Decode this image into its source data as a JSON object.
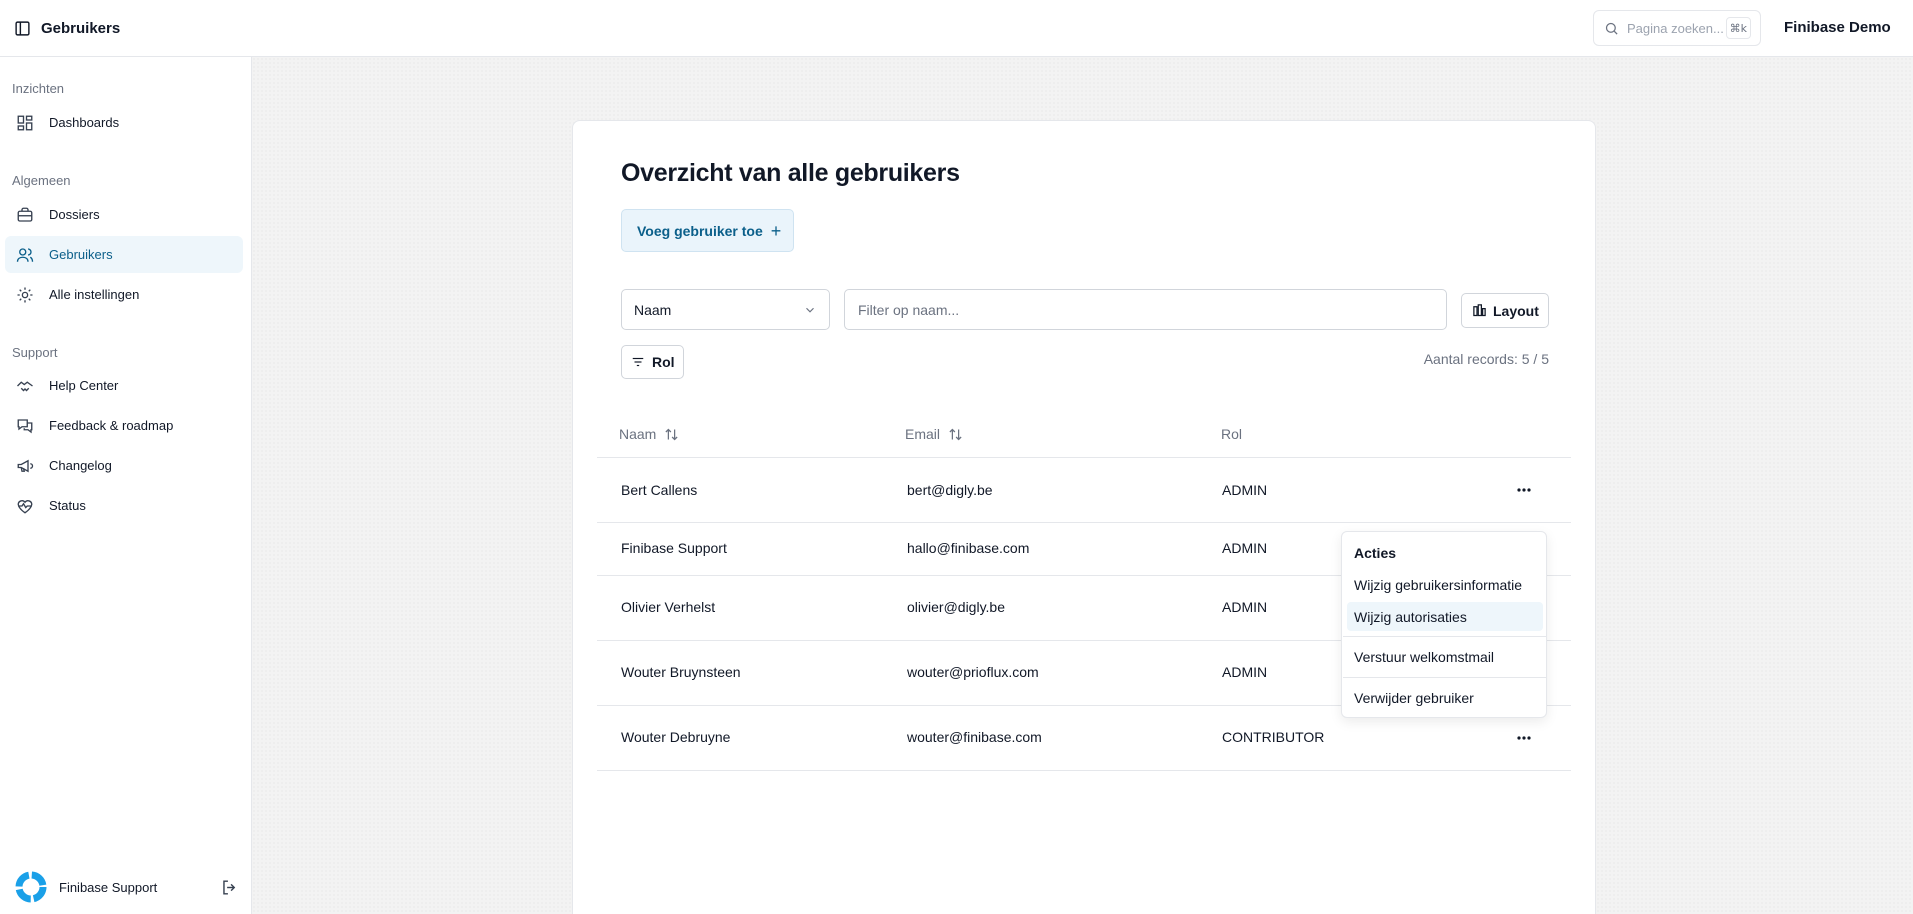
{
  "header": {
    "page_title": "Gebruikers",
    "search_placeholder": "Pagina zoeken...",
    "search_shortcut": "⌘k",
    "organization": "Finibase Demo"
  },
  "sidebar": {
    "groups": [
      {
        "label": "Inzichten",
        "items": [
          {
            "label": "Dashboards",
            "icon": "dashboard-icon"
          }
        ]
      },
      {
        "label": "Algemeen",
        "items": [
          {
            "label": "Dossiers",
            "icon": "briefcase-icon"
          },
          {
            "label": "Gebruikers",
            "icon": "users-icon",
            "active": true
          },
          {
            "label": "Alle instellingen",
            "icon": "gear-icon"
          }
        ]
      },
      {
        "label": "Support",
        "items": [
          {
            "label": "Help Center",
            "icon": "handshake-icon"
          },
          {
            "label": "Feedback & roadmap",
            "icon": "chat-icon"
          },
          {
            "label": "Changelog",
            "icon": "megaphone-icon"
          },
          {
            "label": "Status",
            "icon": "heart-pulse-icon"
          }
        ]
      }
    ],
    "user": "Finibase Support"
  },
  "main": {
    "heading": "Overzicht van alle gebruikers",
    "add_button": "Voeg gebruiker toe",
    "column_select": "Naam",
    "filter_placeholder": "Filter op naam...",
    "layout_button": "Layout",
    "role_filter": "Rol",
    "records": "Aantal records: 5 / 5",
    "columns": [
      "Naam",
      "Email",
      "Rol"
    ],
    "rows": [
      {
        "name": "Bert Callens",
        "email": "bert@digly.be",
        "role": "ADMIN"
      },
      {
        "name": "Finibase Support",
        "email": "hallo@finibase.com",
        "role": "ADMIN"
      },
      {
        "name": "Olivier Verhelst",
        "email": "olivier@digly.be",
        "role": "ADMIN"
      },
      {
        "name": "Wouter Bruynsteen",
        "email": "wouter@prioflux.com",
        "role": "ADMIN"
      },
      {
        "name": "Wouter Debruyne",
        "email": "wouter@finibase.com",
        "role": "CONTRIBUTOR"
      }
    ]
  },
  "actions_menu": {
    "title": "Acties",
    "items": [
      "Wijzig gebruikersinformatie",
      "Wijzig autorisaties",
      "Verstuur welkomstmail",
      "Verwijder gebruiker"
    ],
    "highlighted": "Wijzig autorisaties"
  },
  "colors": {
    "accent": "#0b5f8a",
    "active_bg": "#eef6fb",
    "muted": "#6b7280"
  }
}
